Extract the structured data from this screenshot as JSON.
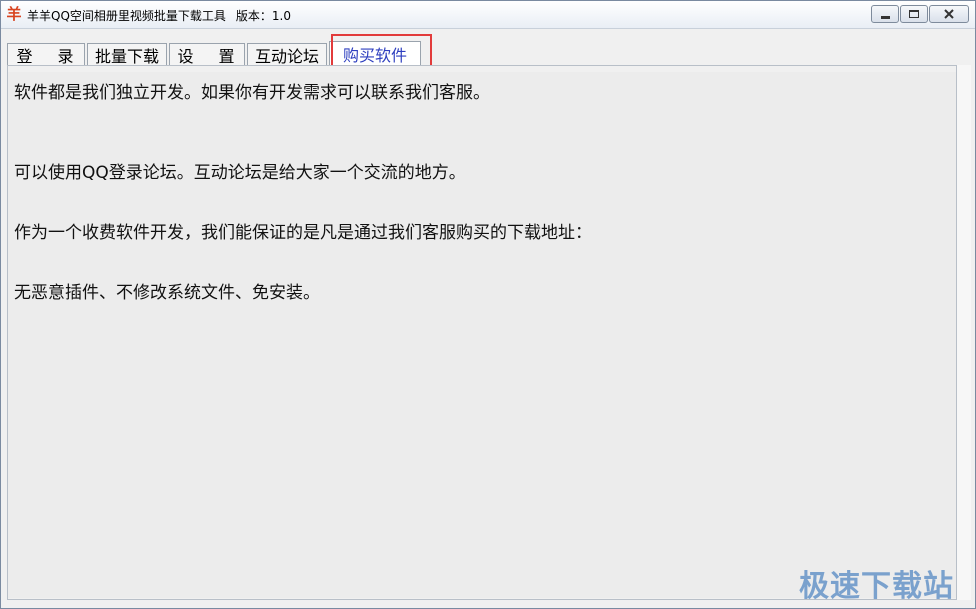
{
  "window": {
    "title": "羊羊QQ空间相册里视频批量下载工具",
    "version": "版本：1.0",
    "icon": "sheep-app-icon",
    "icon_glyph": "羊"
  },
  "tabs": [
    {
      "label": "登 录",
      "active": false
    },
    {
      "label": "批量下载",
      "active": false
    },
    {
      "label": "设 置",
      "active": false
    },
    {
      "label": "互动论坛",
      "active": false
    },
    {
      "label": "购买软件",
      "active": true
    }
  ],
  "content": {
    "lines": [
      "软件都是我们独立开发。如果你有开发需求可以联系我们客服。",
      "可以使用QQ登录论坛。互动论坛是给大家一个交流的地方。",
      "作为一个收费软件开发，我们能保证的是凡是通过我们客服购买的下载地址：",
      "无恶意插件、不修改系统文件、免安装。"
    ]
  },
  "watermark": "极速下载站",
  "colors": {
    "active_tab_text": "#2e3fbf",
    "highlight_box": "#e23b3b",
    "watermark": "#1e64b4"
  }
}
